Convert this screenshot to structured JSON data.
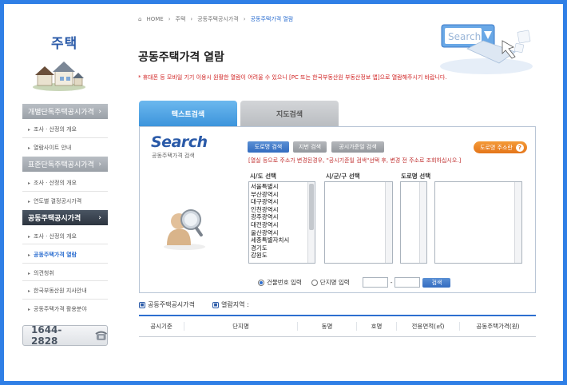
{
  "sidebar": {
    "title": "주택",
    "sections": [
      {
        "label": "개별단독주택공시가격",
        "arrow": "›",
        "items": [
          "조사 · 산정의 개요",
          "열람사이트 안내"
        ]
      },
      {
        "label": "표준단독주택공시가격",
        "arrow": "›",
        "items": [
          "조사 · 산정의 개요",
          "연도별 결정공시가격"
        ]
      },
      {
        "label": "공동주택공시가격",
        "arrow": "›",
        "items": [
          "조사 · 산정의 개요",
          "공동주택가격 열람",
          "의견청취",
          "한국부동산원 지사안내",
          "공동주택가격 활용분야"
        ]
      }
    ],
    "phone": "1644-2828"
  },
  "breadcrumb": [
    "HOME",
    "주택",
    "공동주택공시가격",
    "공동주택가격 열람"
  ],
  "page_title": "공동주택가격 열람",
  "notice": "* 휴대폰 등 모바일 기기 이용시 원활한 열람이 어려울 수 있으니 [PC 또는 한국부동산원 부동산정보 앱]으로 열람해주시기 바랍니다.",
  "illustration_text": "Search",
  "tabs": {
    "text": "텍스트검색",
    "map": "지도검색"
  },
  "search": {
    "brand": "Search",
    "sub": "공동주택가격 검색",
    "buttons": {
      "road": "도로명 검색",
      "jibun": "지번 검색",
      "notice_price": "공시가준일 검색",
      "road_addr": "도로명 주소란",
      "help": "?"
    },
    "hint": "[열실 등으로 주소가 변경된경우, \"공시기준일 검색\"선택 후, 변경 전 주소로 조회하십시오.]",
    "col_sido": "시/도 선택",
    "col_sigungu": "시/군/구 선택",
    "col_road": "도로명 선택",
    "sido_list": [
      "서울특별시",
      "부산광역시",
      "대구광역시",
      "인천광역시",
      "광주광역시",
      "대전광역시",
      "울산광역시",
      "세종특별자치시",
      "경기도",
      "강원도"
    ],
    "radio_building": "건물번호 입력",
    "radio_complex": "단지명 입력",
    "dash": "-",
    "submit": "검색"
  },
  "results": {
    "label1": "공동주택공시가격",
    "label2": "열람지역 :",
    "headers": [
      "공시기준",
      "단지명",
      "동명",
      "호명",
      "전용면적(㎡)",
      "공동주택가격(원)"
    ]
  },
  "colors": {
    "frame": "#2f7fe6",
    "accent": "#2d6fd0",
    "notice": "#d02020"
  }
}
